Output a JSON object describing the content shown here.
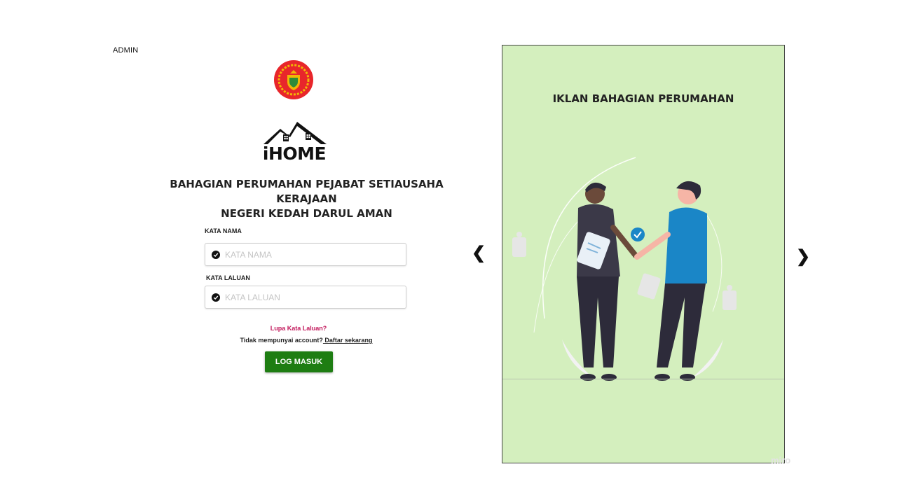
{
  "header": {
    "role_label": "ADMIN"
  },
  "brand": {
    "logo_text": "iHOME",
    "org_title_line1": "BAHAGIAN PERUMAHAN PEJABAT SETIAUSAHA KERAJAAN",
    "org_title_line2": "NEGERI KEDAH DARUL AMAN"
  },
  "form": {
    "username_label": "KATA NAMA",
    "username_placeholder": "KATA NAMA",
    "username_value": "",
    "password_label": "KATA LALUAN",
    "password_placeholder": "KATA LALUAN",
    "password_value": "",
    "forgot_password": "Lupa Kata Laluan?",
    "no_account_text": "Tidak mempunyai account?",
    "register_link": " Daftar sekarang",
    "login_button": "LOG MASUK"
  },
  "carousel": {
    "title": "IKLAN BAHAGIAN PERUMAHAN",
    "prev_icon": "chevron-left-icon",
    "next_icon": "chevron-right-icon",
    "prev_glyph": "❮",
    "next_glyph": "❯"
  },
  "watermark": "miro",
  "colors": {
    "login_button": "#1e7d12",
    "forgot_link": "#c2185b",
    "ad_background": "#d4efbe",
    "emblem_red": "#e8262b",
    "emblem_gold": "#f2b705"
  }
}
